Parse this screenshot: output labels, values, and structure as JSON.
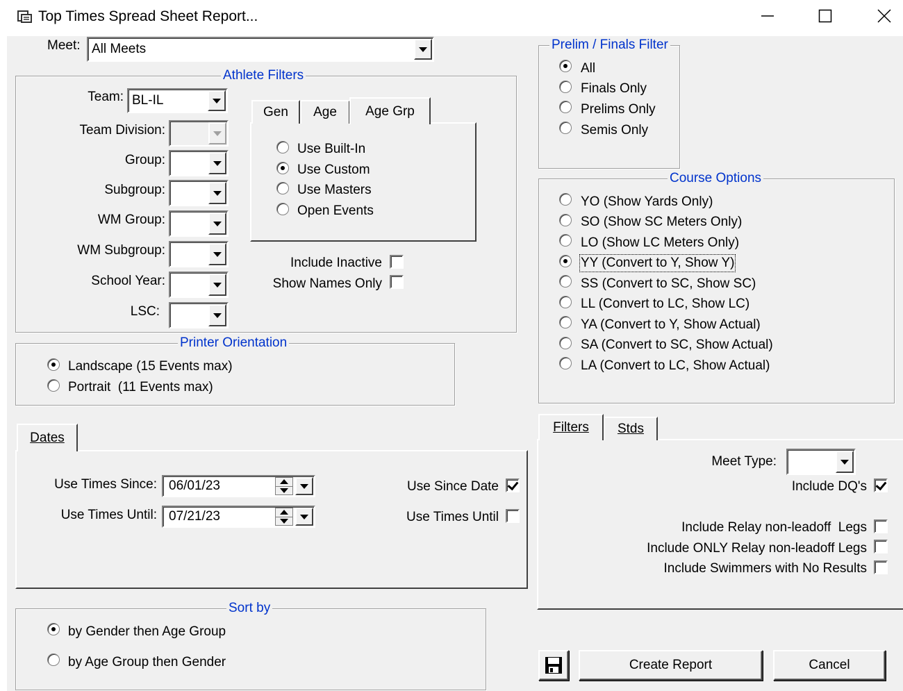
{
  "window": {
    "title": "Top Times Spread Sheet Report...",
    "controls": {
      "minimize": "—",
      "maximize": "☐",
      "close": "✕"
    }
  },
  "meet": {
    "label": "Meet:",
    "value": "All Meets"
  },
  "athlete_filters": {
    "legend": "Athlete Filters",
    "team": {
      "label": "Team:",
      "value": "BL-IL"
    },
    "fields": [
      {
        "label": "Team Division:",
        "value": "",
        "disabled": true
      },
      {
        "label": "Group:",
        "value": ""
      },
      {
        "label": "Subgroup:",
        "value": ""
      },
      {
        "label": "WM Group:",
        "value": ""
      },
      {
        "label": "WM Subgroup:",
        "value": ""
      },
      {
        "label": "School Year:",
        "value": ""
      },
      {
        "label": "LSC:",
        "value": ""
      }
    ],
    "tabs": [
      "Gen",
      "Age",
      "Age Grp"
    ],
    "active_tab": "Age Grp",
    "age_options": [
      "Use Built-In",
      "Use Custom",
      "Use Masters",
      "Open Events"
    ],
    "age_selected": "Use Custom",
    "include_inactive": {
      "label": "Include Inactive",
      "checked": false
    },
    "show_names_only": {
      "label": "Show Names Only",
      "checked": false
    }
  },
  "printer_orientation": {
    "legend": "Printer Orientation",
    "options": [
      "Landscape (15 Events max)",
      "Portrait  (11 Events max)"
    ],
    "selected": "Landscape (15 Events max)"
  },
  "dates": {
    "tab": "Dates",
    "since": {
      "label": "Use Times Since:",
      "value": "06/01/23"
    },
    "until": {
      "label": "Use Times Until:",
      "value": "07/21/23"
    },
    "use_since_date": {
      "label": "Use Since Date",
      "checked": true
    },
    "use_times_until": {
      "label": "Use Times Until",
      "checked": false
    }
  },
  "sort_by": {
    "legend": "Sort by",
    "options": [
      "by Gender then Age Group",
      "by Age Group then Gender"
    ],
    "selected": "by Gender then Age Group"
  },
  "prelim_finals": {
    "legend": "Prelim / Finals Filter",
    "options": [
      "All",
      "Finals Only",
      "Prelims Only",
      "Semis Only"
    ],
    "selected": "All"
  },
  "course_options": {
    "legend": "Course Options",
    "options": [
      "YO (Show Yards Only)",
      "SO (Show SC Meters Only)",
      "LO (Show LC Meters Only)",
      "YY (Convert to Y, Show Y)",
      "SS (Convert to SC, Show SC)",
      "LL (Convert to LC, Show LC)",
      "YA (Convert to Y, Show Actual)",
      "SA (Convert to SC, Show Actual)",
      "LA (Convert to LC, Show Actual)"
    ],
    "selected": "YY (Convert to Y, Show Y)"
  },
  "filters": {
    "tabs": [
      "Filters",
      "Stds"
    ],
    "meet_type": {
      "label": "Meet Type:",
      "value": ""
    },
    "include_dqs": {
      "label": "Include DQ's",
      "checked": true
    },
    "checks": [
      {
        "label": "Include Relay non-leadoff  Legs",
        "checked": false
      },
      {
        "label": "Include ONLY Relay non-leadoff Legs",
        "checked": false
      },
      {
        "label": "Include Swimmers with No Results",
        "checked": false
      }
    ]
  },
  "buttons": {
    "save_icon": "floppy-disk-icon",
    "create": "Create Report",
    "cancel": "Cancel"
  }
}
